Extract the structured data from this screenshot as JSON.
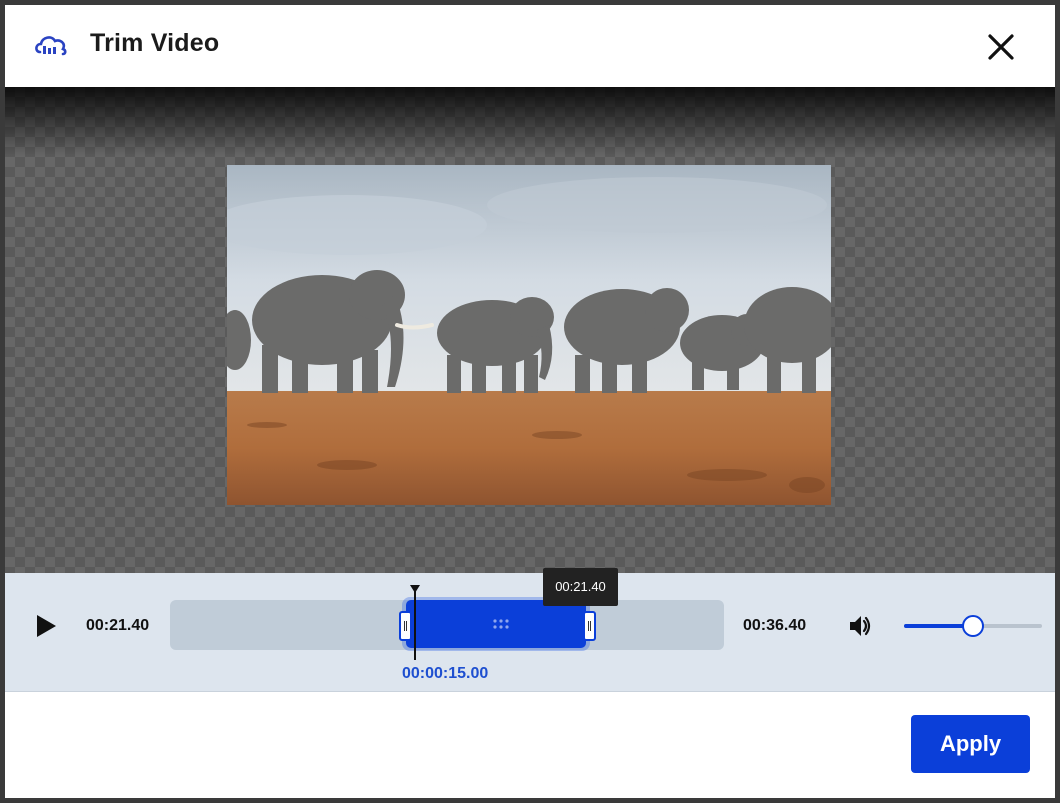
{
  "dialog": {
    "title": "Trim Video",
    "logo_icon": "cloud-logo-icon",
    "close_icon": "close-icon"
  },
  "player": {
    "play_icon": "play-icon",
    "current_time": "00:21.40",
    "end_time": "00:36.40",
    "playhead_tooltip": "00:21.40",
    "selection_duration": "00:00:15.00",
    "volume_icon": "volume-icon",
    "volume_level": 0.5
  },
  "footer": {
    "apply_label": "Apply"
  },
  "colors": {
    "accent": "#0b3fd9",
    "duration_text": "#1e4fd0",
    "controls_background": "#dde5ee"
  }
}
